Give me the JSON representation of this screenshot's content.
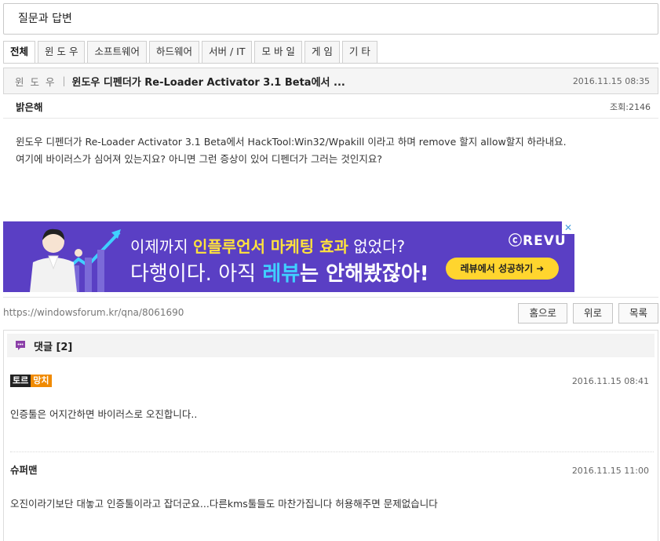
{
  "board": {
    "title": "질문과 답변"
  },
  "tabs": [
    {
      "label": "전체",
      "active": true
    },
    {
      "label": "윈 도 우",
      "active": false
    },
    {
      "label": "소프트웨어",
      "active": false
    },
    {
      "label": "하드웨어",
      "active": false
    },
    {
      "label": "서버 / IT",
      "active": false
    },
    {
      "label": "모 바 일",
      "active": false
    },
    {
      "label": "게 임",
      "active": false
    },
    {
      "label": "기 타",
      "active": false
    }
  ],
  "post": {
    "category": "윈 도 우",
    "separator": "|",
    "title": "윈도우 디펜더가 Re-Loader Activator 3.1 Beta에서 ...",
    "date": "2016.11.15 08:35",
    "author": "밝은해",
    "views": "조회:2146",
    "body_lines": [
      "윈도우 디펜더가 Re-Loader Activator 3.1 Beta에서 HackTool:Win32/Wpakill 이라고 하며   remove 할지 allow할지 하라내요.",
      "여기에 바이러스가 심어져 있는지요? 아니면 그런 증상이 있어 디펜더가 그러는 것인지요?"
    ]
  },
  "ad": {
    "line1_prefix": "이제까지 ",
    "line1_highlight": "인플루언서 마케팅 효과",
    "line1_suffix": " 없었다?",
    "line2_prefix": "다행이다. 아직 ",
    "line2_highlight": "레뷰",
    "line2_bold": "는 안해봤잖아!",
    "brand": "ⓒREVU",
    "cta": "레뷰에서 성공하기 ➜",
    "close": "✕",
    "colors": {
      "bg": "#5a3fc4",
      "yellow": "#ffe23c",
      "cyan": "#3fd0ff",
      "cta": "#ffd52e"
    }
  },
  "url": "https://windowsforum.kr/qna/8061690",
  "buttons": {
    "home": "홈으로",
    "top": "위로",
    "list": "목록"
  },
  "comments": {
    "title": "댓글 [2]",
    "icon": "speech-bubble-icon",
    "items": [
      {
        "badge_left": "토르",
        "badge_right": "망치",
        "date": "2016.11.15 08:41",
        "body": "인증툴은 어지간하면 바이러스로 오진합니다.."
      },
      {
        "author": "슈퍼맨",
        "date": "2016.11.15 11:00",
        "body": "오진이라기보단 대놓고 인증툴이라고 잡더군요...다른kms툴들도 마찬가집니다 허용해주면 문제없습니다"
      }
    ]
  }
}
